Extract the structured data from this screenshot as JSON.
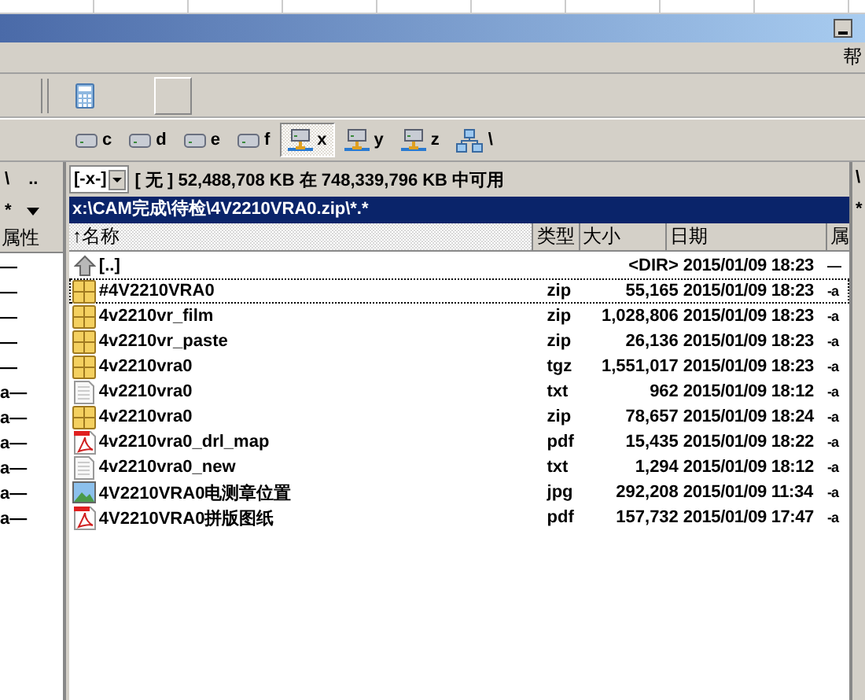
{
  "menu": [
    "帮"
  ],
  "drives": [
    {
      "label": "c",
      "kind": "disk",
      "selected": false
    },
    {
      "label": "d",
      "kind": "disk",
      "selected": false
    },
    {
      "label": "e",
      "kind": "disk",
      "selected": false
    },
    {
      "label": "f",
      "kind": "disk",
      "selected": false
    },
    {
      "label": "x",
      "kind": "network",
      "selected": true
    },
    {
      "label": "y",
      "kind": "network",
      "selected": false
    },
    {
      "label": "z",
      "kind": "network",
      "selected": false
    },
    {
      "label": "\\",
      "kind": "network-root",
      "selected": false
    }
  ],
  "left_panel": {
    "root": "\\",
    "parent": "..",
    "filter": "*",
    "attr_header": "属性",
    "rows": [
      "—",
      "—",
      "—",
      "—",
      "—",
      "a—",
      "a—",
      "a—",
      "a—",
      "a—",
      "a—"
    ]
  },
  "right_panel": {
    "drive": "[-x-]",
    "free_space": "[ 无 ] 52,488,708 KB 在 748,339,796 KB 中可用",
    "path": "x:\\CAM完成\\待检\\4V2210VRA0.zip\\*.*",
    "columns": [
      "↑名称",
      "类型",
      "大小",
      "日期",
      "属"
    ],
    "files": [
      {
        "name": "[..]",
        "size": "<DIR>",
        "date": "2015/01/09 18:23",
        "attr": "—",
        "kind": "up",
        "focused": false
      },
      {
        "name": "#4V2210VRA0",
        "type": "zip",
        "size": "55,165",
        "date": "2015/01/09 18:23",
        "attr": "-a",
        "kind": "archive",
        "focused": true
      },
      {
        "name": "4v2210vr_film",
        "type": "zip",
        "size": "1,028,806",
        "date": "2015/01/09 18:23",
        "attr": "-a",
        "kind": "archive",
        "focused": false
      },
      {
        "name": "4v2210vr_paste",
        "type": "zip",
        "size": "26,136",
        "date": "2015/01/09 18:23",
        "attr": "-a",
        "kind": "archive",
        "focused": false
      },
      {
        "name": "4v2210vra0",
        "type": "tgz",
        "size": "1,551,017",
        "date": "2015/01/09 18:23",
        "attr": "-a",
        "kind": "archive",
        "focused": false
      },
      {
        "name": "4v2210vra0",
        "type": "txt",
        "size": "962",
        "date": "2015/01/09 18:12",
        "attr": "-a",
        "kind": "text",
        "focused": false
      },
      {
        "name": "4v2210vra0",
        "type": "zip",
        "size": "78,657",
        "date": "2015/01/09 18:24",
        "attr": "-a",
        "kind": "archive",
        "focused": false
      },
      {
        "name": "4v2210vra0_drl_map",
        "type": "pdf",
        "size": "15,435",
        "date": "2015/01/09 18:22",
        "attr": "-a",
        "kind": "pdf",
        "focused": false
      },
      {
        "name": "4v2210vra0_new",
        "type": "txt",
        "size": "1,294",
        "date": "2015/01/09 18:12",
        "attr": "-a",
        "kind": "text",
        "focused": false
      },
      {
        "name": "4V2210VRA0电测章位置",
        "type": "jpg",
        "size": "292,208",
        "date": "2015/01/09 11:34",
        "attr": "-a",
        "kind": "image",
        "focused": false
      },
      {
        "name": "4V2210VRA0拼版图纸",
        "type": "pdf",
        "size": "157,732",
        "date": "2015/01/09 17:47",
        "attr": "-a",
        "kind": "pdf",
        "focused": false
      }
    ]
  },
  "edge_panel": {
    "root": "\\",
    "filter": "*"
  }
}
